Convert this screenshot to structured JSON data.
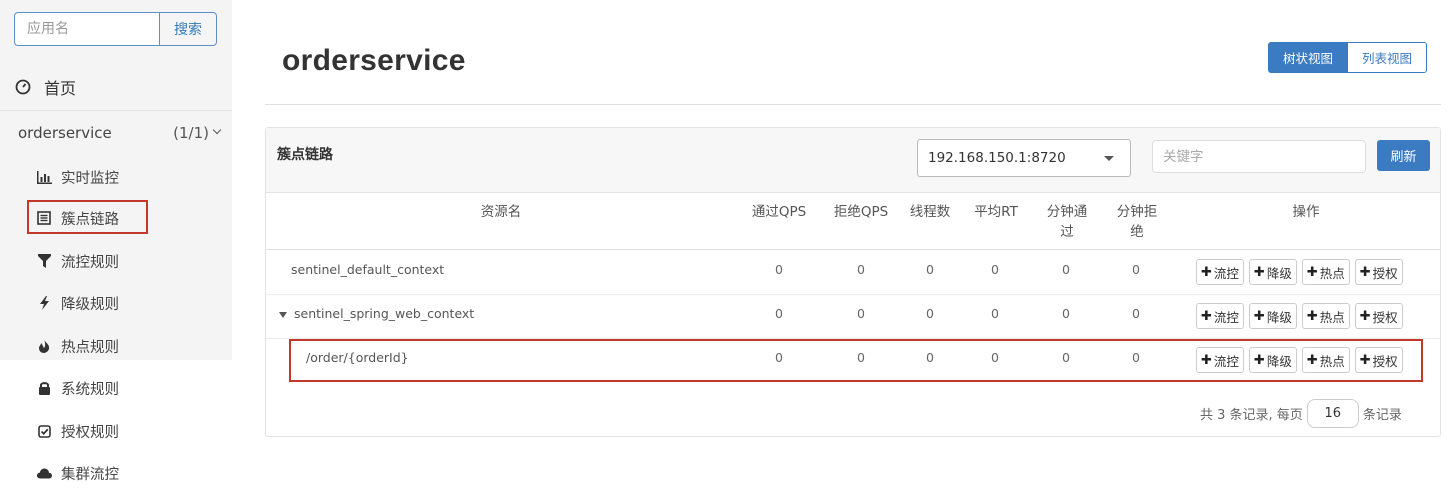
{
  "sidebar": {
    "search": {
      "placeholder": "应用名",
      "button_label": "搜索"
    },
    "home_label": "首页",
    "app": {
      "name": "orderservice",
      "count": "(1/1)"
    },
    "items": [
      {
        "label": "实时监控",
        "icon": "bar-chart-icon"
      },
      {
        "label": "簇点链路",
        "icon": "list-icon",
        "active": true
      },
      {
        "label": "流控规则",
        "icon": "filter-icon"
      },
      {
        "label": "降级规则",
        "icon": "flash-icon"
      },
      {
        "label": "热点规则",
        "icon": "fire-icon"
      },
      {
        "label": "系统规则",
        "icon": "lock-icon"
      },
      {
        "label": "授权规则",
        "icon": "check-icon"
      },
      {
        "label": "集群流控",
        "icon": "cloud-icon"
      }
    ]
  },
  "main": {
    "title": "orderservice",
    "view_toggle": {
      "tree_label": "树状视图",
      "list_label": "列表视图",
      "active": "tree"
    },
    "panel": {
      "title": "簇点链路",
      "machine": "192.168.150.1:8720",
      "keyword_placeholder": "关键字",
      "refresh_label": "刷新"
    },
    "table": {
      "headers": {
        "resource": "资源名",
        "pass_qps": "通过QPS",
        "block_qps": "拒绝QPS",
        "threads": "线程数",
        "avg_rt": "平均RT",
        "min_pass": "分钟通过",
        "min_block": "分钟拒绝",
        "ops": "操作"
      },
      "rows": [
        {
          "name": "sentinel_default_context",
          "pass_qps": "0",
          "block_qps": "0",
          "threads": "0",
          "avg_rt": "0",
          "min_pass": "0",
          "min_block": "0"
        },
        {
          "name": "sentinel_spring_web_context",
          "pass_qps": "0",
          "block_qps": "0",
          "threads": "0",
          "avg_rt": "0",
          "min_pass": "0",
          "min_block": "0"
        },
        {
          "name": "/order/{orderId}",
          "pass_qps": "0",
          "block_qps": "0",
          "threads": "0",
          "avg_rt": "0",
          "min_pass": "0",
          "min_block": "0"
        }
      ],
      "op_buttons": {
        "flow": "流控",
        "degrade": "降级",
        "hotspot": "热点",
        "auth": "授权"
      }
    },
    "pager": {
      "prefix": "共 3 条记录, 每页",
      "page_size": "16",
      "suffix": "条记录"
    }
  },
  "colors": {
    "primary": "#3a7bc2",
    "highlight_border": "#c0392b",
    "sidebar_bg": "#f4f4f4"
  }
}
